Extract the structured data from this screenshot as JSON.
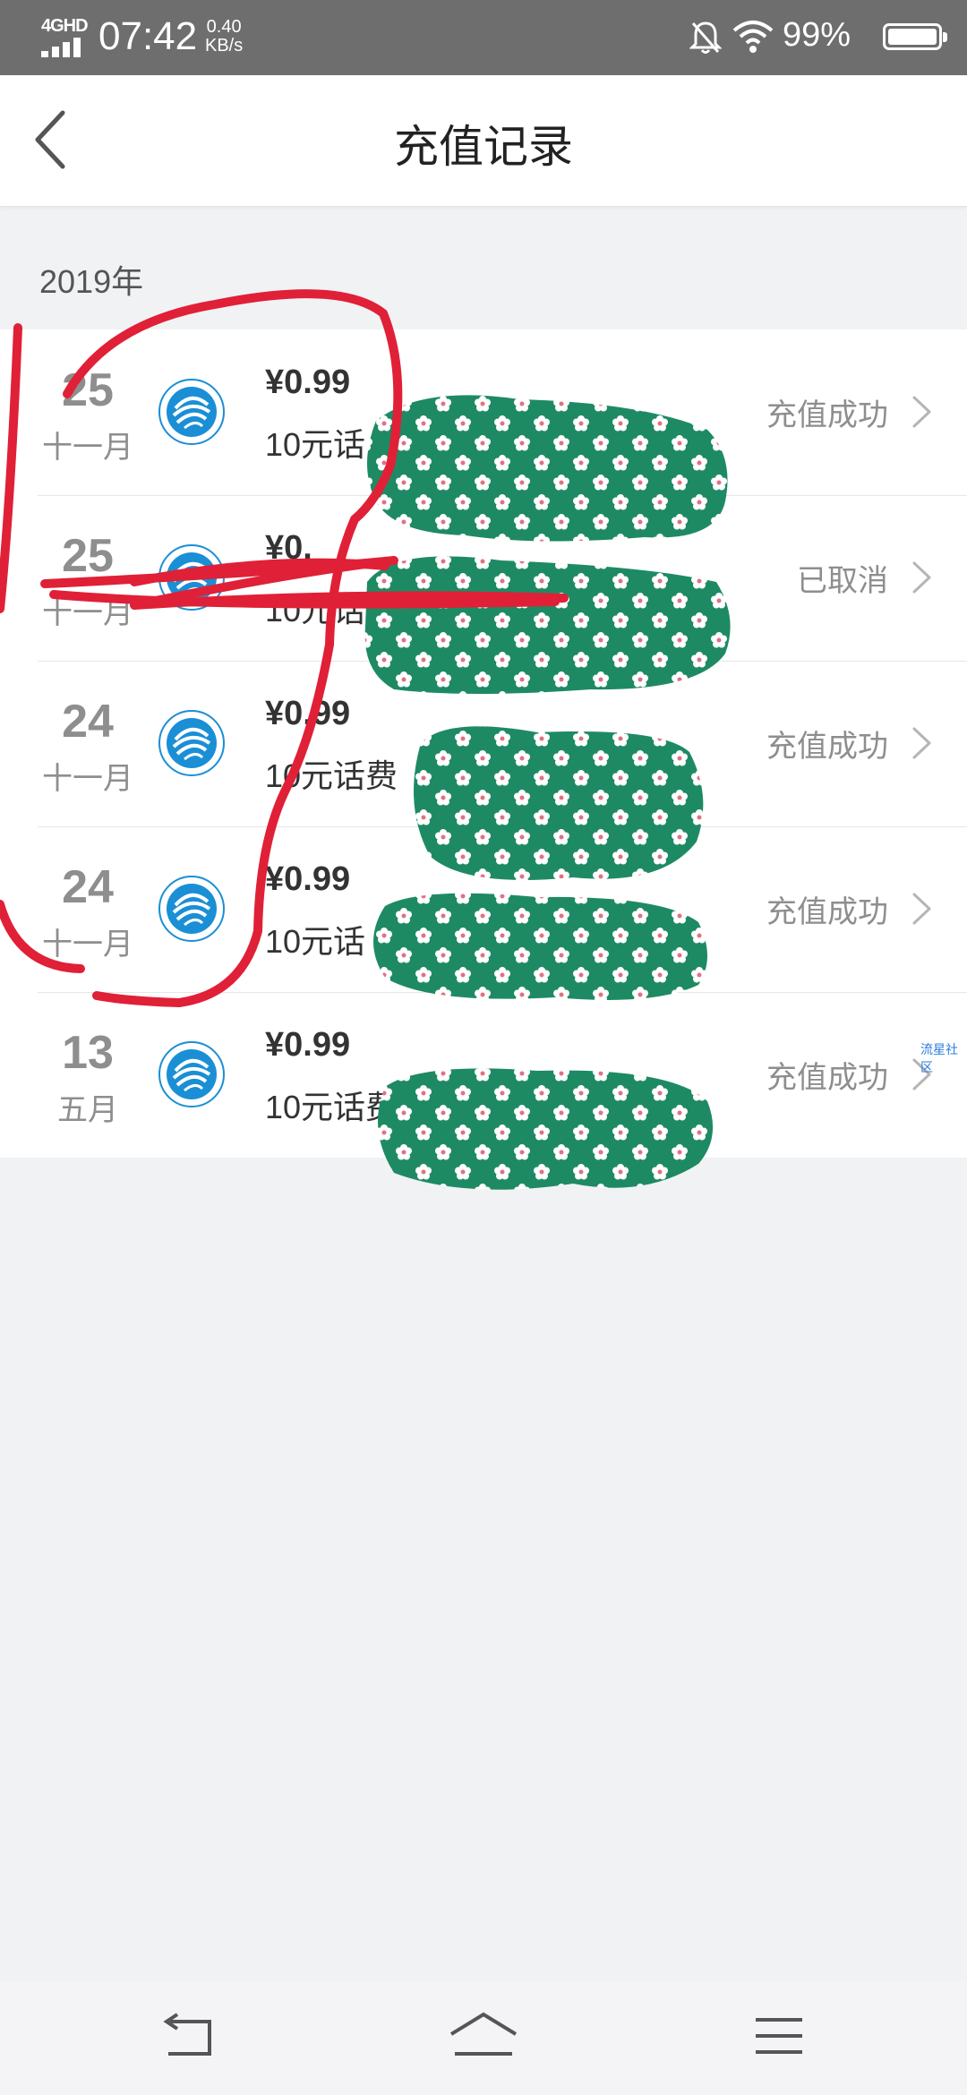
{
  "status_bar": {
    "network": "4GHD",
    "time": "07:42",
    "speed_value": "0.40",
    "speed_unit": "KB/s",
    "battery": "99%",
    "icons": [
      "signal-icon",
      "bell-off-icon",
      "wifi-icon",
      "battery-icon"
    ]
  },
  "header": {
    "title": "充值记录",
    "back_icon": "chevron-left-icon"
  },
  "section": {
    "year": "2019年"
  },
  "records": [
    {
      "day": "25",
      "month": "十一月",
      "amount": "¥0.99",
      "desc": "10元话",
      "status": "充值成功"
    },
    {
      "day": "25",
      "month": "十一月",
      "amount": "¥0.",
      "desc": "10元话",
      "status": "已取消"
    },
    {
      "day": "24",
      "month": "十一月",
      "amount": "¥0.99",
      "desc": "10元话费",
      "status": "充值成功"
    },
    {
      "day": "24",
      "month": "十一月",
      "amount": "¥0.99",
      "desc": "10元话",
      "status": "充值成功"
    },
    {
      "day": "13",
      "month": "五月",
      "amount": "¥0.99",
      "desc": "10元话费",
      "status": "充值成功"
    }
  ],
  "watermark": "流星社区",
  "colors": {
    "status_bar": "#6e6e6e",
    "operator_blue": "#1a8fd6",
    "scribble_red": "#e02037",
    "sticker_green": "#1e8a63"
  },
  "navbar": {
    "icons": [
      "back-nav-icon",
      "home-nav-icon",
      "menu-nav-icon"
    ]
  }
}
